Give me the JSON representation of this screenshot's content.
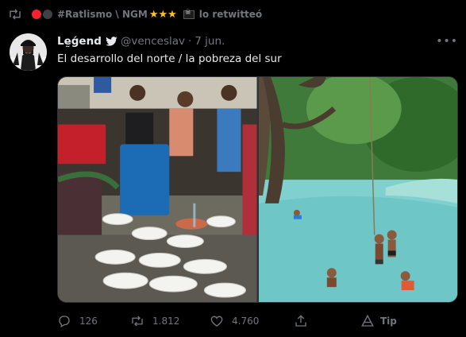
{
  "retweet_context": {
    "display_name": "#Ratlismo \\ NGM",
    "stars": "★★★",
    "action_text": "lo retwitteó"
  },
  "tweet": {
    "author_name": "Lḛǵend",
    "author_handle": "@venceslav",
    "separator": "·",
    "date": "7 jun.",
    "text": "El desarrollo del norte / la pobreza del sur",
    "replies": "126",
    "retweets": "1.812",
    "likes": "4.760",
    "tip_label": "Tip"
  },
  "colors": {
    "background": "#000000",
    "text_primary": "#e7e9ea",
    "text_secondary": "#71767b",
    "accent_red": "#f4212e",
    "star_gold": "#ffc21a"
  },
  "icons": {
    "retweet_context": "retweet-icon",
    "badge": "bird-icon",
    "more": "more-icon",
    "reply": "reply-icon",
    "retweet": "retweet-icon",
    "like": "heart-icon",
    "share": "share-icon",
    "tip": "tip-icon"
  }
}
